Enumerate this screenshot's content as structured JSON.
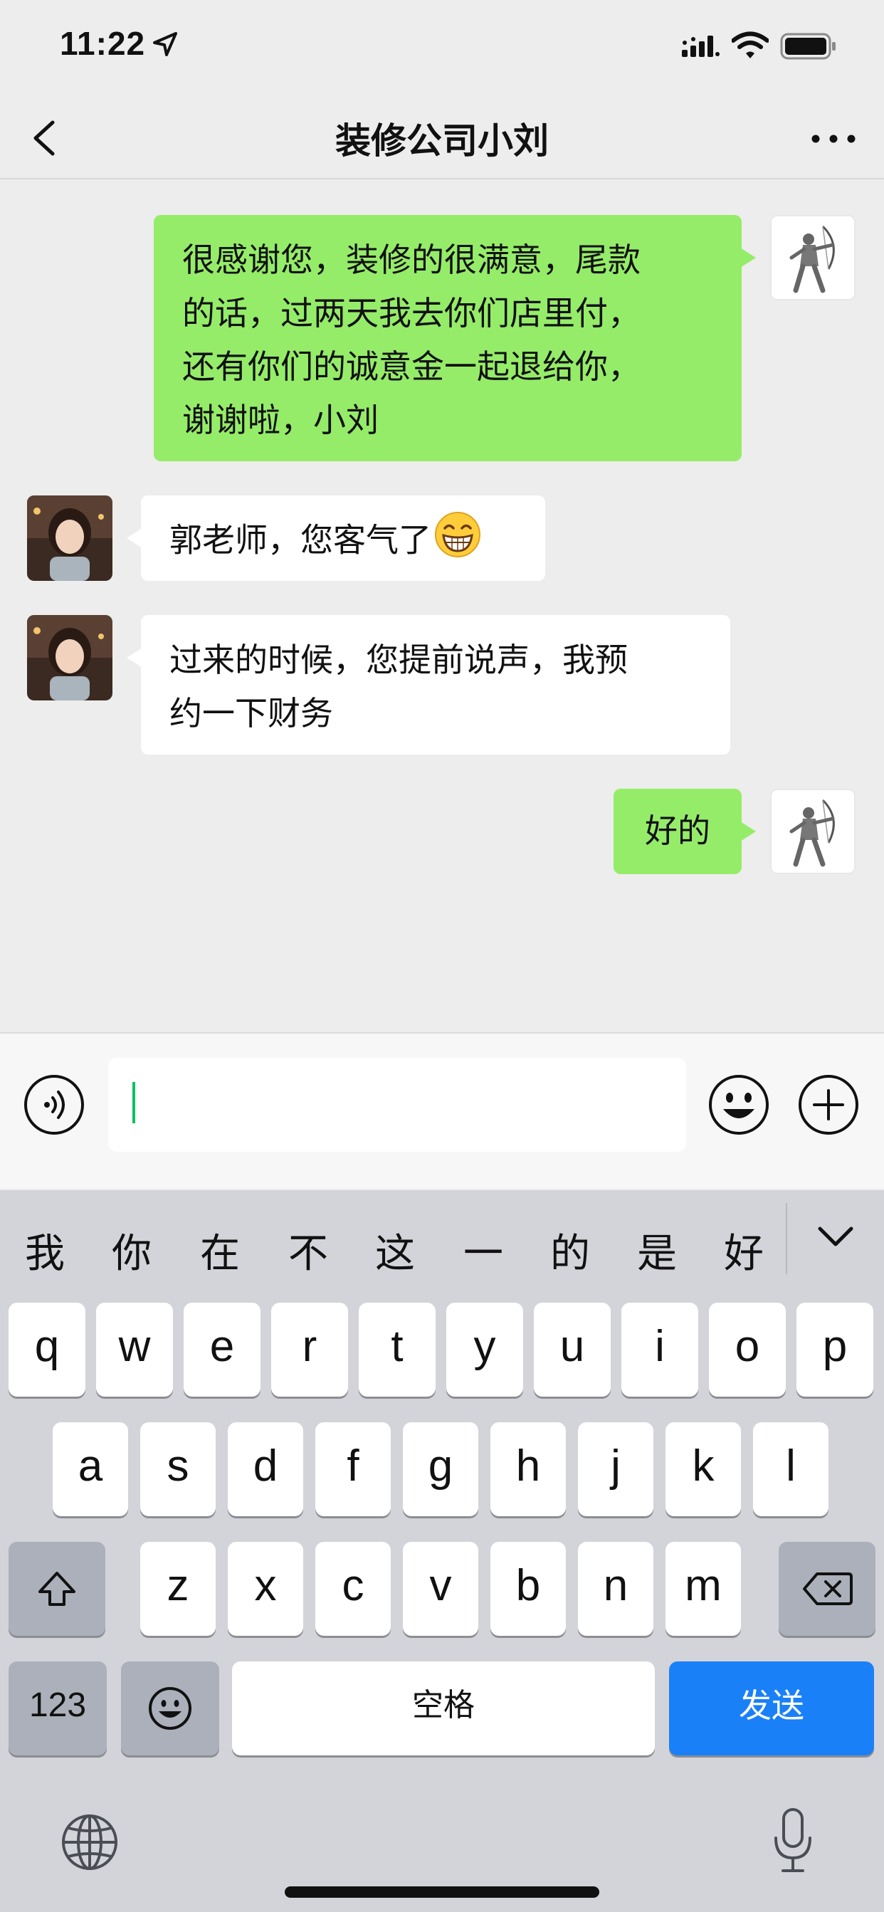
{
  "status_bar": {
    "time": "11:22"
  },
  "chat": {
    "title": "装修公司小刘",
    "messages": [
      {
        "direction": "out",
        "lines": [
          "很感谢您，装修的很满意，尾款",
          "的话，过两天我去你们店里付，",
          "还有你们的诚意金一起退给你，",
          "谢谢啦，小刘"
        ]
      },
      {
        "direction": "in",
        "text": "郭老师，您客气了",
        "emoji": "grinning-face-emoji"
      },
      {
        "direction": "in",
        "lines": [
          "过来的时候，您提前说声，我预",
          "约一下财务"
        ]
      },
      {
        "direction": "out",
        "text": "好的"
      }
    ]
  },
  "input": {
    "value": ""
  },
  "keyboard": {
    "candidates": [
      "我",
      "你",
      "在",
      "不",
      "这",
      "一",
      "的",
      "是",
      "好"
    ],
    "row1": [
      "q",
      "w",
      "e",
      "r",
      "t",
      "y",
      "u",
      "i",
      "o",
      "p"
    ],
    "row2": [
      "a",
      "s",
      "d",
      "f",
      "g",
      "h",
      "j",
      "k",
      "l"
    ],
    "row3": [
      "z",
      "x",
      "c",
      "v",
      "b",
      "n",
      "m"
    ],
    "numbers_label": "123",
    "space_label": "空格",
    "send_label": "发送"
  },
  "colors": {
    "outgoing_bubble": "#95ec69",
    "incoming_bubble": "#ffffff",
    "send_key": "#1a80f7",
    "caret": "#07c160"
  }
}
